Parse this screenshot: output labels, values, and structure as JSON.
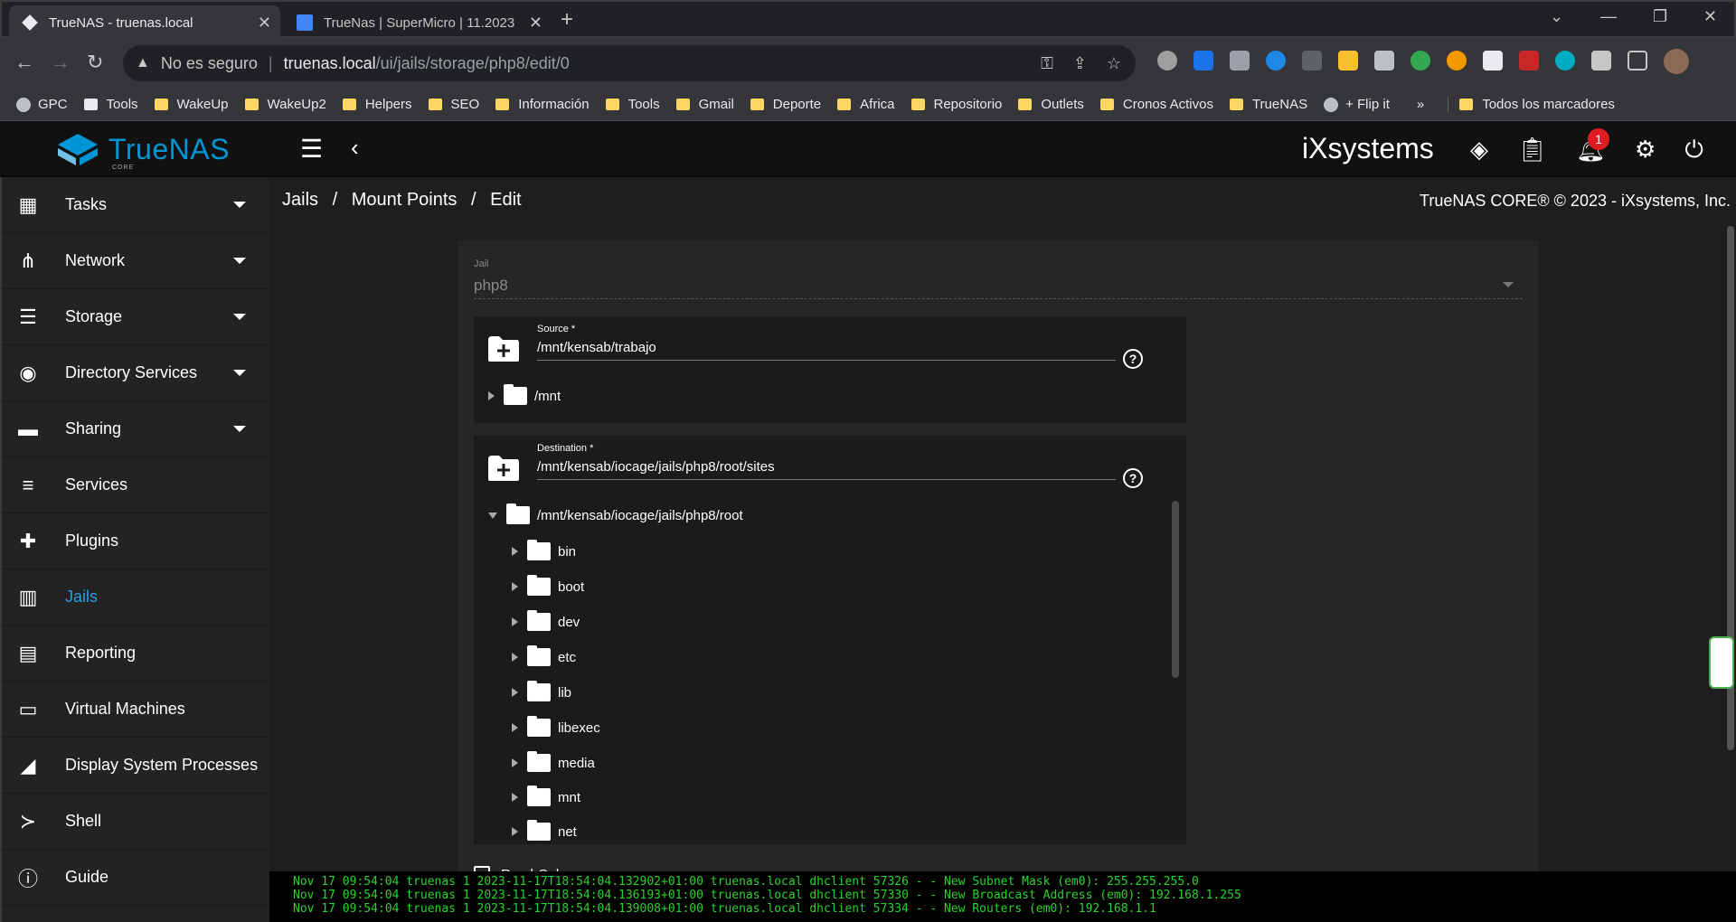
{
  "browser": {
    "tabs": [
      {
        "title": "TrueNAS - truenas.local",
        "active": true
      },
      {
        "title": "TrueNas | SuperMicro | 11.2023",
        "active": false
      }
    ],
    "address": {
      "security_label": "No es seguro",
      "host": "truenas.local",
      "path": "/ui/jails/storage/php8/edit/0"
    },
    "bookmarks": [
      "GPC",
      "Tools",
      "WakeUp",
      "WakeUp2",
      "Helpers",
      "SEO",
      "Información",
      "Tools",
      "Gmail",
      "Deporte",
      "Africa",
      "Repositorio",
      "Outlets",
      "Cronos Activos",
      "TrueNAS",
      "+ Flip it"
    ],
    "all_bookmarks": "Todos los marcadores",
    "more_bookmarks": "»"
  },
  "topbar": {
    "brand": "TrueNAS",
    "edition": "CORE",
    "vendor": "iXsystems",
    "notification_count": "1"
  },
  "sidebar": {
    "items": [
      {
        "label": "Tasks",
        "icon": "calendar-icon",
        "expandable": true
      },
      {
        "label": "Network",
        "icon": "network-icon",
        "expandable": true
      },
      {
        "label": "Storage",
        "icon": "storage-icon",
        "expandable": true
      },
      {
        "label": "Directory Services",
        "icon": "directory-icon",
        "expandable": true
      },
      {
        "label": "Sharing",
        "icon": "sharing-folder-icon",
        "expandable": true
      },
      {
        "label": "Services",
        "icon": "tune-icon",
        "expandable": false
      },
      {
        "label": "Plugins",
        "icon": "puzzle-icon",
        "expandable": false
      },
      {
        "label": "Jails",
        "icon": "jail-icon",
        "expandable": false,
        "active": true
      },
      {
        "label": "Reporting",
        "icon": "chart-icon",
        "expandable": false
      },
      {
        "label": "Virtual Machines",
        "icon": "laptop-icon",
        "expandable": false
      },
      {
        "label": "Display System Processes",
        "icon": "processes-icon",
        "expandable": false
      },
      {
        "label": "Shell",
        "icon": "terminal-icon",
        "expandable": false
      },
      {
        "label": "Guide",
        "icon": "info-icon",
        "expandable": false
      }
    ]
  },
  "breadcrumb": {
    "items": [
      "Jails",
      "/",
      "Mount Points",
      "/",
      "Edit"
    ]
  },
  "copyright": "TrueNAS CORE® © 2023 - iXsystems, Inc.",
  "form": {
    "jail": {
      "label": "Jail",
      "value": "php8"
    },
    "source": {
      "label": "Source *",
      "value": "/mnt/kensab/trabajo",
      "tree_root": "/mnt"
    },
    "destination": {
      "label": "Destination *",
      "value": "/mnt/kensab/iocage/jails/php8/root/sites",
      "tree_root": "/mnt/kensab/iocage/jails/php8/root",
      "children": [
        "bin",
        "boot",
        "dev",
        "etc",
        "lib",
        "libexec",
        "media",
        "mnt",
        "net"
      ]
    },
    "read_only_label": "Read-Only",
    "help_glyph": "?"
  },
  "console": {
    "lines": [
      "Nov 17 09:54:04 truenas 1 2023-11-17T18:54:04.132902+01:00 truenas.local dhclient 57326 - - New Subnet Mask (em0): 255.255.255.0",
      "Nov 17 09:54:04 truenas 1 2023-11-17T18:54:04.136193+01:00 truenas.local dhclient 57330 - - New Broadcast Address (em0): 192.168.1.255",
      "Nov 17 09:54:04 truenas 1 2023-11-17T18:54:04.139008+01:00 truenas.local dhclient 57334 - - New Routers (em0): 192.168.1.1"
    ]
  },
  "colors": {
    "accent": "#0095d5",
    "active_link": "#2b9fe2",
    "console_text": "#27d42b",
    "badge": "#e01c23"
  }
}
